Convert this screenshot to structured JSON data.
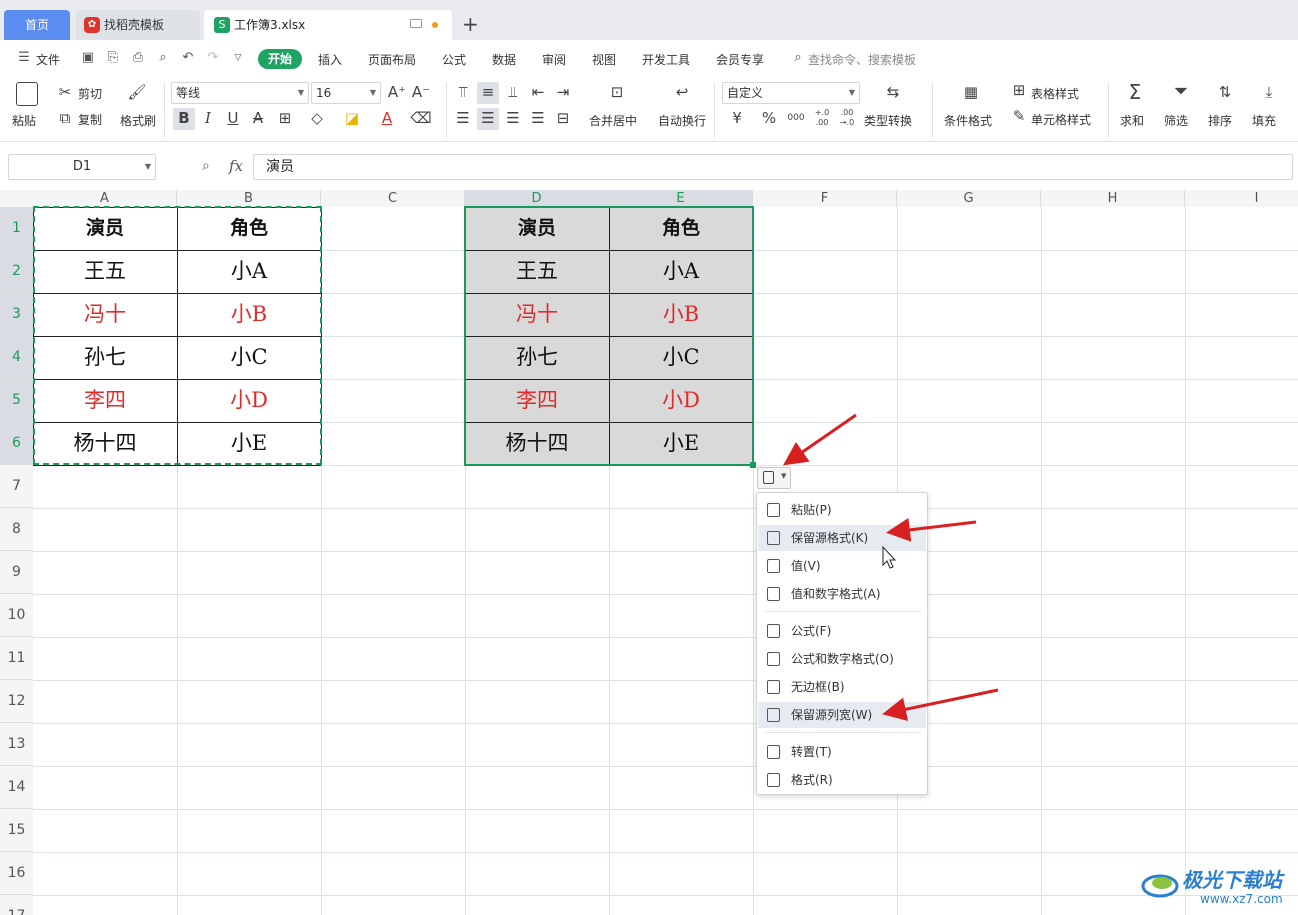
{
  "tabs": {
    "home": "首页",
    "template": "找稻壳模板",
    "workbook": "工作簿3.xlsx",
    "new_tab": "+"
  },
  "menu": {
    "file": "文件",
    "items": [
      "开始",
      "插入",
      "页面布局",
      "公式",
      "数据",
      "审阅",
      "视图",
      "开发工具",
      "会员专享"
    ],
    "search_placeholder": "查找命令、搜索模板"
  },
  "ribbon": {
    "paste": "粘贴",
    "cut": "剪切",
    "copy": "复制",
    "format_painter": "格式刷",
    "font_name": "等线",
    "font_size": "16",
    "merge_center": "合并居中",
    "wrap_text": "自动换行",
    "number_format": "自定义",
    "type_convert": "类型转换",
    "conditional_format": "条件格式",
    "table_style": "表格样式",
    "cell_style": "单元格样式",
    "sum": "求和",
    "filter": "筛选",
    "sort": "排序",
    "fill": "填充",
    "bold": "B",
    "italic": "I",
    "underline": "U",
    "font_color": "A",
    "currency": "¥",
    "percent": "%",
    "thousands": "000",
    "inc_decimal": "+.0 .00",
    "dec_decimal": ".00 →.0"
  },
  "formula_bar": {
    "name_box": "D1",
    "fx": "fx",
    "content": "演员"
  },
  "columns": [
    "A",
    "B",
    "C",
    "D",
    "E",
    "F",
    "G",
    "H",
    "I"
  ],
  "rows": [
    "1",
    "2",
    "3",
    "4",
    "5",
    "6",
    "7",
    "8",
    "9",
    "10",
    "11",
    "12",
    "13",
    "14",
    "15",
    "16",
    "17"
  ],
  "source_table": [
    [
      "演员",
      "角色"
    ],
    [
      "王五",
      "小A"
    ],
    [
      "冯十",
      "小B"
    ],
    [
      "孙七",
      "小C"
    ],
    [
      "李四",
      "小D"
    ],
    [
      "杨十四",
      "小E"
    ]
  ],
  "pasted_table": [
    [
      "演员",
      "角色"
    ],
    [
      "王五",
      "小A"
    ],
    [
      "冯十",
      "小B"
    ],
    [
      "孙七",
      "小C"
    ],
    [
      "李四",
      "小D"
    ],
    [
      "杨十四",
      "小E"
    ]
  ],
  "red_rows": [
    2,
    4
  ],
  "colors": {
    "accent_green": "#1ea362",
    "red_text": "#e12b2b",
    "arrow_red": "#d82020",
    "tab_blue": "#5b8df0"
  },
  "paste_menu": {
    "items": [
      "粘贴(P)",
      "保留源格式(K)",
      "值(V)",
      "值和数字格式(A)",
      "公式(F)",
      "公式和数字格式(O)",
      "无边框(B)",
      "保留源列宽(W)",
      "转置(T)",
      "格式(R)"
    ]
  },
  "watermark": {
    "title": "极光下载站",
    "url": "www.xz7.com"
  }
}
